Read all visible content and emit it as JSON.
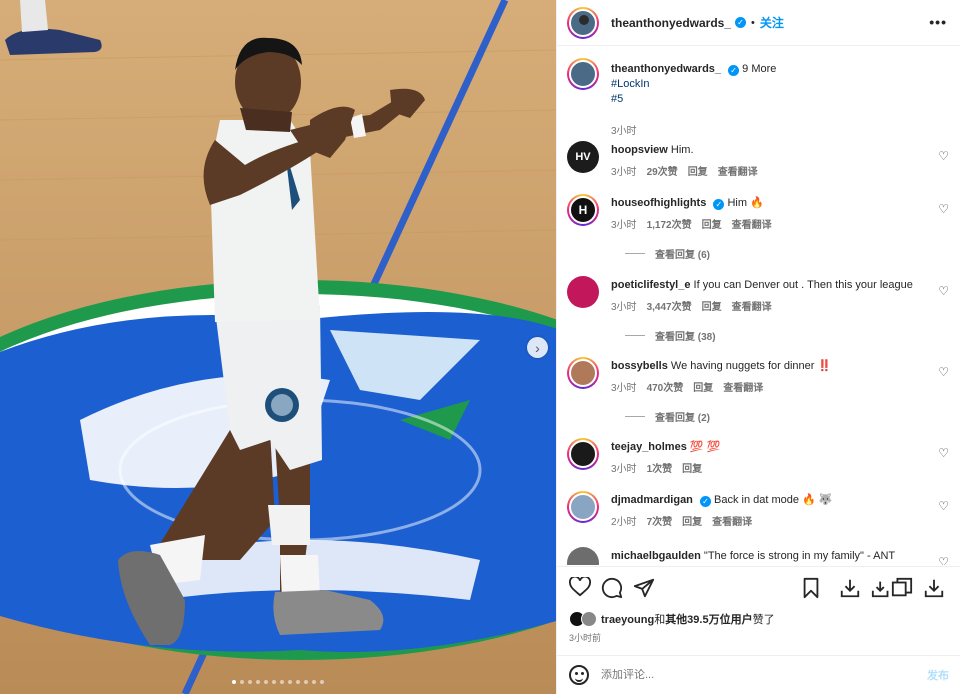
{
  "media": {
    "slide_count": 12,
    "active_slide": 1,
    "next_icon": "chevron-right-icon"
  },
  "header": {
    "username": "theanthonyedwards_",
    "separator": "•",
    "follow_label": "关注",
    "more_icon": "ellipsis-icon"
  },
  "caption": {
    "username": "theanthonyedwards_",
    "more_text": "9 More",
    "hashtag1": "#LockIn",
    "hashtag2": "#5",
    "time": "3小时"
  },
  "comments": [
    {
      "username": "hoopsview",
      "text": "Him.",
      "time": "3小时",
      "likes": "29次赞",
      "reply": "回复",
      "translate": "查看翻译",
      "avatar_color": "#1c1c1c",
      "avatar_text": "HV"
    },
    {
      "username": "houseofhighlights",
      "text": "Him 🔥",
      "time": "3小时",
      "likes": "1,172次赞",
      "reply": "回复",
      "translate": "查看翻译",
      "view_replies": "查看回复 (6)",
      "avatar_color": "#111111",
      "avatar_text": "H"
    },
    {
      "username": "poeticlifestyl_e",
      "text": "If you can Denver out . Then this your league",
      "time": "3小时",
      "likes": "3,447次赞",
      "reply": "回复",
      "translate": "查看翻译",
      "view_replies": "查看回复 (38)",
      "avatar_color": "#c2185b"
    },
    {
      "username": "bossybells",
      "text": "We having nuggets for dinner ‼️",
      "time": "3小时",
      "likes": "470次赞",
      "reply": "回复",
      "translate": "查看翻译",
      "view_replies": "查看回复 (2)",
      "avatar_color": "#b07a5a"
    },
    {
      "username": "teejay_holmes",
      "text": "💯 💯",
      "time": "3小时",
      "likes": "1次赞",
      "reply": "回复",
      "avatar_color": "#1a1a1a"
    },
    {
      "username": "djmadmardigan",
      "text": "Back in dat mode 🔥 🐺",
      "time": "2小时",
      "likes": "7次赞",
      "reply": "回复",
      "translate": "查看翻译",
      "avatar_color": "#8aa5c2"
    },
    {
      "username": "michaelbgaulden",
      "text": "\"The force is strong in my family\" - ANT",
      "avatar_color": "#6d6d6d"
    }
  ],
  "actions": {
    "like_icon": "heart-icon",
    "comment_icon": "comment-icon",
    "share_icon": "send-icon",
    "save_icon": "bookmark-icon",
    "download_icon": "download-icon"
  },
  "likes": {
    "user": "traeyoung",
    "joiner": "和",
    "others": "其他39.5万位用户",
    "suffix": "赞了"
  },
  "post_time": "3小时前",
  "comment_box": {
    "placeholder": "添加评论...",
    "post_label": "发布"
  }
}
